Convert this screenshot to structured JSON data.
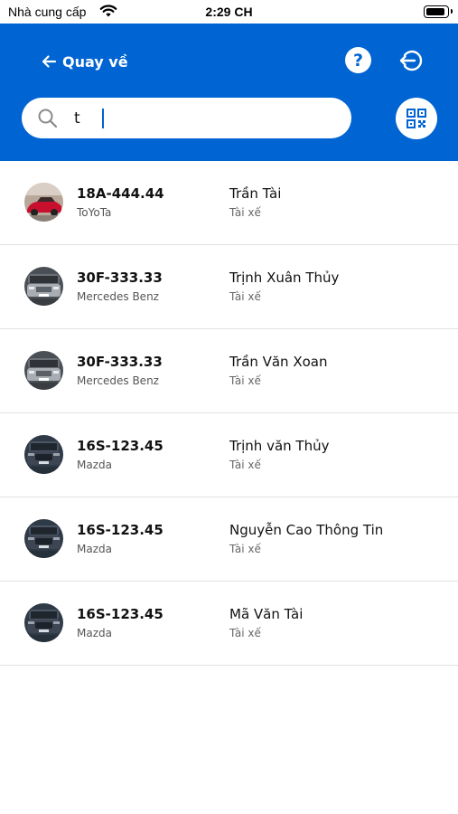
{
  "status_bar": {
    "carrier": "Nhà cung cấp",
    "time": "2:29 CH"
  },
  "header": {
    "back_label": "Quay về",
    "help_label": "?"
  },
  "search": {
    "value": "t",
    "placeholder": ""
  },
  "colors": {
    "primary": "#0064d2",
    "divider": "#e1e1e1"
  },
  "vehicles": [
    {
      "plate": "18A-444.44",
      "brand": "ToYoTa",
      "driver": "Trần Tài",
      "role": "Tài xế",
      "photo": "red-car"
    },
    {
      "plate": "30F-333.33",
      "brand": "Mercedes Benz",
      "driver": "Trịnh Xuân Thủy",
      "role": "Tài xế",
      "photo": "silver-car"
    },
    {
      "plate": "30F-333.33",
      "brand": "Mercedes Benz",
      "driver": "Trần Văn Xoan",
      "role": "Tài xế",
      "photo": "silver-car"
    },
    {
      "plate": "16S-123.45",
      "brand": "Mazda",
      "driver": "Trịnh văn Thủy",
      "role": "Tài xế",
      "photo": "dark-car"
    },
    {
      "plate": "16S-123.45",
      "brand": "Mazda",
      "driver": "Nguyễn Cao Thông Tin",
      "role": "Tài xế",
      "photo": "dark-car"
    },
    {
      "plate": "16S-123.45",
      "brand": "Mazda",
      "driver": "Mã Văn Tài",
      "role": "Tài xế",
      "photo": "dark-car"
    }
  ]
}
